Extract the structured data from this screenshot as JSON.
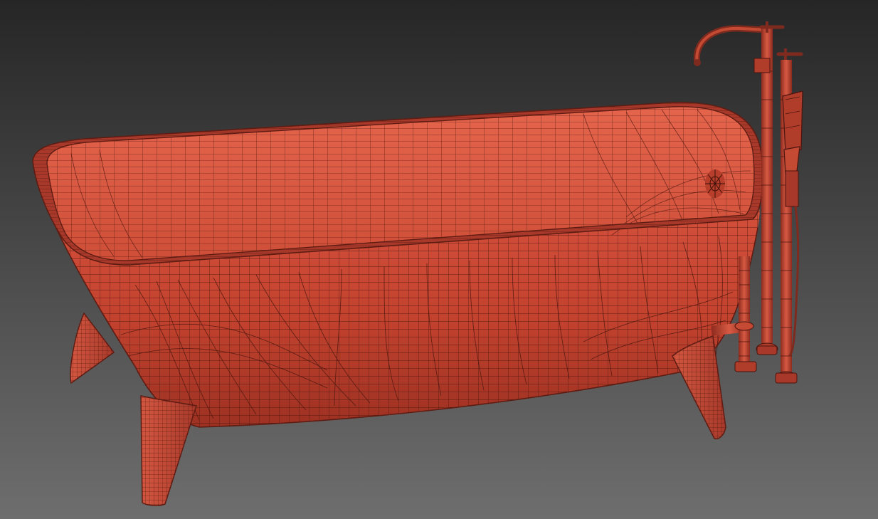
{
  "viewport": {
    "background_top": "#262626",
    "background_bottom": "#6e6e6e"
  },
  "model": {
    "object_name": "freestanding-bathtub-with-floor-mounted-faucet",
    "render_mode": "wireframe-on-shaded",
    "shade_color": "#c94733",
    "shade_light": "#e0654c",
    "shade_dark": "#7e2a1e",
    "wire_color": "#4a150e",
    "rim_color": "#a8392a"
  }
}
